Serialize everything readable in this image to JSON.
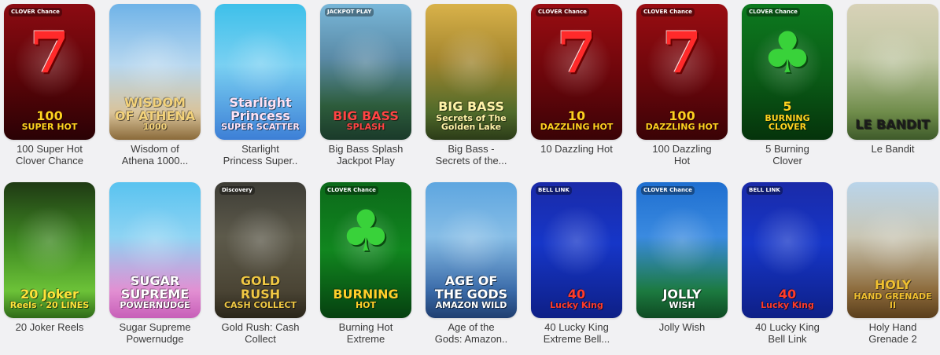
{
  "games": [
    {
      "caption": [
        "100 Super Hot",
        "Clover Chance"
      ],
      "art": [
        "100",
        "SUPER HOT"
      ],
      "bg": "linear-gradient(180deg,#8c0b12 0%,#5a0408 55%,#2a0205 100%)",
      "textColor": "#ffd21f",
      "glyph": "7",
      "badge": "CLOVER Chance"
    },
    {
      "caption": [
        "Wisdom of",
        "Athena 1000..."
      ],
      "art": [
        "WISDOM OF ATHENA",
        "1000"
      ],
      "bg": "linear-gradient(180deg,#6fb3e8 0%,#b7d7ef 45%,#d9c39a 80%,#8a6a3a 100%)",
      "textColor": "#f3d27a",
      "glyph": "",
      "badge": ""
    },
    {
      "caption": [
        "Starlight",
        "Princess Super.."
      ],
      "art": [
        "Starlight Princess",
        "SUPER SCATTER"
      ],
      "bg": "linear-gradient(180deg,#3ec0ea 0%,#79d0f2 45%,#3d7fd6 100%)",
      "textColor": "#ffe3f6",
      "glyph": "",
      "badge": ""
    },
    {
      "caption": [
        "Big Bass Splash",
        "Jackpot Play"
      ],
      "art": [
        "BIG BASS",
        "SPLASH"
      ],
      "bg": "linear-gradient(180deg,#79b7d9 0%,#5a8aa6 40%,#2d5c3b 75%,#1a3a2a 100%)",
      "textColor": "#ff4444",
      "glyph": "",
      "badge": "JACKPOT PLAY"
    },
    {
      "caption": [
        "Big Bass -",
        "Secrets of the..."
      ],
      "art": [
        "BIG BASS",
        "Secrets of The Golden Lake"
      ],
      "bg": "linear-gradient(180deg,#d9b24a 0%,#a5872f 40%,#4f6a2a 80%,#2c3c18 100%)",
      "textColor": "#fff2a8",
      "glyph": "",
      "badge": ""
    },
    {
      "caption": [
        "10 Dazzling Hot"
      ],
      "art": [
        "10",
        "DAZZLING HOT"
      ],
      "bg": "linear-gradient(180deg,#9a0d12 0%,#6a060b 55%,#3a0306 100%)",
      "textColor": "#ffcf1f",
      "glyph": "7",
      "badge": "CLOVER Chance"
    },
    {
      "caption": [
        "100 Dazzling",
        "Hot"
      ],
      "art": [
        "100",
        "DAZZLING HOT"
      ],
      "bg": "linear-gradient(180deg,#9a0d12 0%,#6a060b 55%,#3a0306 100%)",
      "textColor": "#ffcf1f",
      "glyph": "7",
      "badge": "CLOVER Chance"
    },
    {
      "caption": [
        "5 Burning",
        "Clover"
      ],
      "art": [
        "5",
        "BURNING CLOVER"
      ],
      "bg": "linear-gradient(180deg,#0d7a1f 0%,#0a5a16 55%,#05330b 100%)",
      "textColor": "#ffd21f",
      "glyph": "♣",
      "badge": "CLOVER Chance"
    },
    {
      "caption": [
        "Le Bandit"
      ],
      "art": [
        "LE BANDIT",
        ""
      ],
      "bg": "linear-gradient(180deg,#d8d2b8 0%,#bfc6a2 40%,#6f8c4a 80%,#3e5a2a 100%)",
      "textColor": "#1b1b1b",
      "glyph": "",
      "badge": ""
    },
    {
      "caption": [
        "20 Joker Reels"
      ],
      "art": [
        "20 Joker",
        "Reels · 20 LINES"
      ],
      "bg": "linear-gradient(180deg,#1f3a14 0%,#3f8a22 45%,#6cc238 80%,#2f6a18 100%)",
      "textColor": "#ffe23a",
      "glyph": "",
      "badge": ""
    },
    {
      "caption": [
        "Sugar Supreme",
        "Powernudge"
      ],
      "art": [
        "SUGAR SUPREME",
        "POWERNUDGE"
      ],
      "bg": "linear-gradient(180deg,#59c3f0 0%,#8dd3f3 40%,#e28fd2 80%,#c75fb8 100%)",
      "textColor": "#ffffff",
      "glyph": "",
      "badge": ""
    },
    {
      "caption": [
        "Gold Rush: Cash",
        "Collect"
      ],
      "art": [
        "GOLD RUSH",
        "CASH COLLECT"
      ],
      "bg": "linear-gradient(180deg,#3e3d36 0%,#5d5a4b 40%,#4a4434 80%,#2a2519 100%)",
      "textColor": "#f0c844",
      "glyph": "",
      "badge": "Discovery"
    },
    {
      "caption": [
        "Burning Hot",
        "Extreme"
      ],
      "art": [
        "BURNING",
        "HOT"
      ],
      "bg": "linear-gradient(180deg,#0c6a1a 0%,#11861f 50%,#064010 100%)",
      "textColor": "#ffcf2a",
      "glyph": "♣",
      "badge": "CLOVER Chance"
    },
    {
      "caption": [
        "Age of the",
        "Gods: Amazon.."
      ],
      "art": [
        "AGE OF THE GODS",
        "AMAZON WILD"
      ],
      "bg": "linear-gradient(180deg,#5ea6e0 0%,#86bde6 40%,#3a6aa8 80%,#1f3e70 100%)",
      "textColor": "#ffffff",
      "glyph": "",
      "badge": ""
    },
    {
      "caption": [
        "40 Lucky King",
        "Extreme Bell..."
      ],
      "art": [
        "40",
        "Lucky King"
      ],
      "bg": "linear-gradient(180deg,#1a2aa8 0%,#1636c8 45%,#0e1f86 100%)",
      "textColor": "#ff3b2a",
      "glyph": "",
      "badge": "BELL LINK"
    },
    {
      "caption": [
        "Jolly Wish"
      ],
      "art": [
        "JOLLY",
        "WISH"
      ],
      "bg": "linear-gradient(180deg,#1f6fd0 0%,#3a8ae0 40%,#1c7a40 80%,#0e4a22 100%)",
      "textColor": "#ffffff",
      "glyph": "",
      "badge": "CLOVER Chance"
    },
    {
      "caption": [
        "40 Lucky King",
        "Bell Link"
      ],
      "art": [
        "40",
        "Lucky King"
      ],
      "bg": "linear-gradient(180deg,#1a2aa8 0%,#1636c8 45%,#0e1f86 100%)",
      "textColor": "#ff3b2a",
      "glyph": "",
      "badge": "BELL LINK"
    },
    {
      "caption": [
        "Holy Hand",
        "Grenade 2"
      ],
      "art": [
        "HOLY",
        "HAND GRENADE II"
      ],
      "bg": "linear-gradient(180deg,#b9d4ea 0%,#c9c6b4 40%,#8c6a3a 80%,#5a3e1c 100%)",
      "textColor": "#f0c030",
      "glyph": "",
      "badge": ""
    }
  ]
}
